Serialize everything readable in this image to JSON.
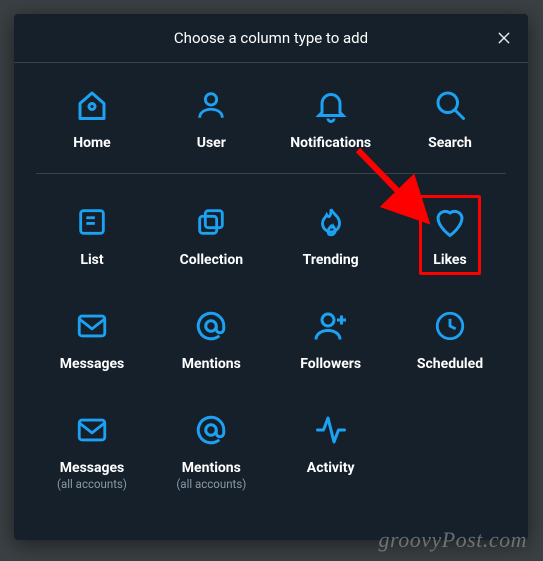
{
  "modal": {
    "title": "Choose a column type to add"
  },
  "items": {
    "home": {
      "label": "Home"
    },
    "user": {
      "label": "User"
    },
    "notifications": {
      "label": "Notifications"
    },
    "search": {
      "label": "Search"
    },
    "list": {
      "label": "List"
    },
    "collection": {
      "label": "Collection"
    },
    "trending": {
      "label": "Trending"
    },
    "likes": {
      "label": "Likes"
    },
    "messages": {
      "label": "Messages"
    },
    "mentions": {
      "label": "Mentions"
    },
    "followers": {
      "label": "Followers"
    },
    "scheduled": {
      "label": "Scheduled"
    },
    "messages_all": {
      "label": "Messages",
      "sublabel": "(all accounts)"
    },
    "mentions_all": {
      "label": "Mentions",
      "sublabel": "(all accounts)"
    },
    "activity": {
      "label": "Activity"
    }
  },
  "annotation": {
    "highlighted_item": "likes",
    "arrow_color": "#ff0000"
  },
  "watermark": "groovyPost.com"
}
